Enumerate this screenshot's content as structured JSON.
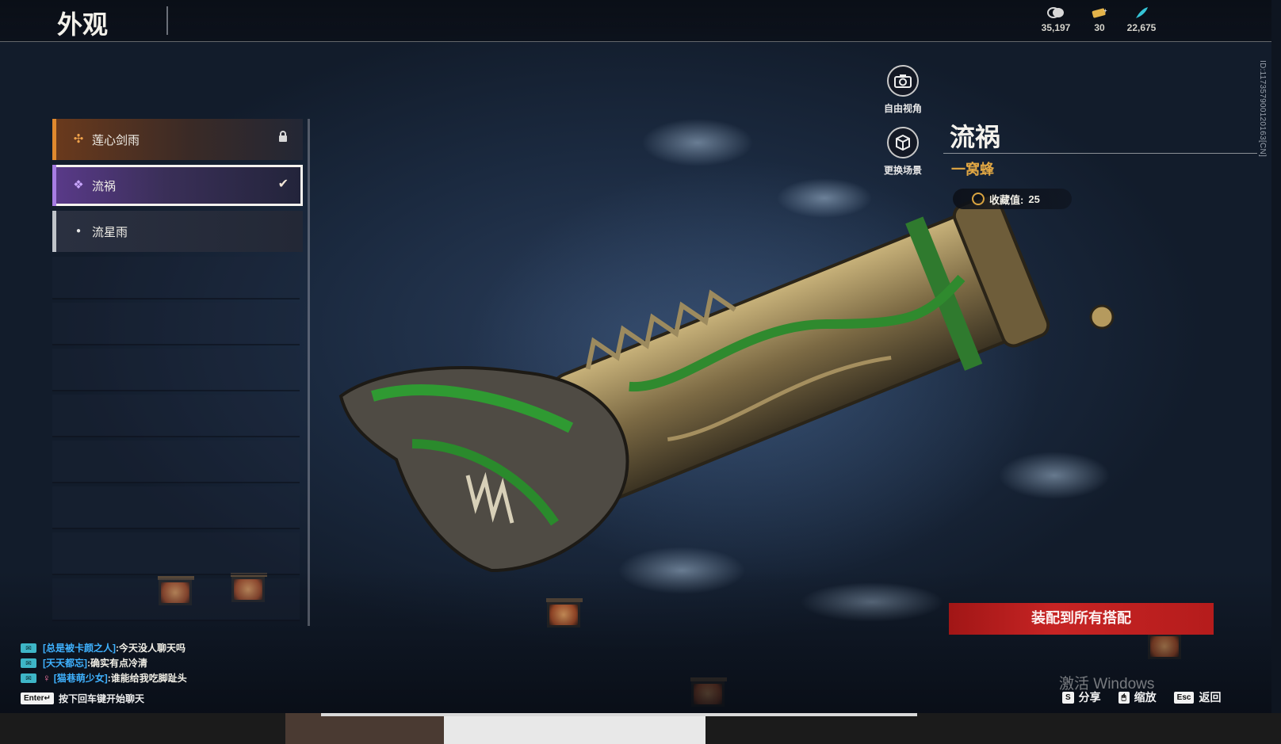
{
  "header": {
    "title": "外观",
    "currencies": [
      {
        "icon": "coin-stack-icon",
        "value": "35,197"
      },
      {
        "icon": "ticket-icon",
        "value": "30"
      },
      {
        "icon": "feather-icon",
        "value": "22,675"
      }
    ]
  },
  "skin_list": {
    "items": [
      {
        "name": "莲心剑雨",
        "rarity": "orange",
        "state": "locked"
      },
      {
        "name": "流祸",
        "rarity": "purple",
        "state": "equipped-selected"
      },
      {
        "name": "流星雨",
        "rarity": "white",
        "state": "owned"
      }
    ],
    "empty_slots": 8
  },
  "view_buttons": {
    "free_camera": "自由视角",
    "change_scene": "更换场景"
  },
  "skin_detail": {
    "name": "流祸",
    "weapon_type": "一窝蜂",
    "collection_label": "收藏值:",
    "collection_value": "25"
  },
  "actions": {
    "equip_all": "装配到所有搭配"
  },
  "client_id": "ID:117357900120163[CN]",
  "chat": {
    "lines": [
      {
        "user": "[总是被卡颜之人]",
        "message": ":今天没人聊天吗",
        "gender_icon": ""
      },
      {
        "user": "[天天都忘]",
        "message": ":确实有点冷清",
        "gender_icon": ""
      },
      {
        "user": "[猫巷萌少女]",
        "message": ":谁能给我吃脚趾头",
        "gender_icon": "♀"
      }
    ],
    "enter_key": "Enter↵",
    "enter_hint": "按下回车键开始聊天"
  },
  "hints": [
    {
      "key": "S",
      "label": "分享"
    },
    {
      "key": "🖱",
      "label": "缩放"
    },
    {
      "key": "Esc",
      "label": "返回"
    }
  ],
  "watermark": "激活 Windows",
  "colors": {
    "accent_red": "#c72424",
    "orange_rarity": "#e0892e",
    "purple_rarity": "#a77de3",
    "gold_text": "#e1a743",
    "chat_user": "#3fb2ff"
  }
}
